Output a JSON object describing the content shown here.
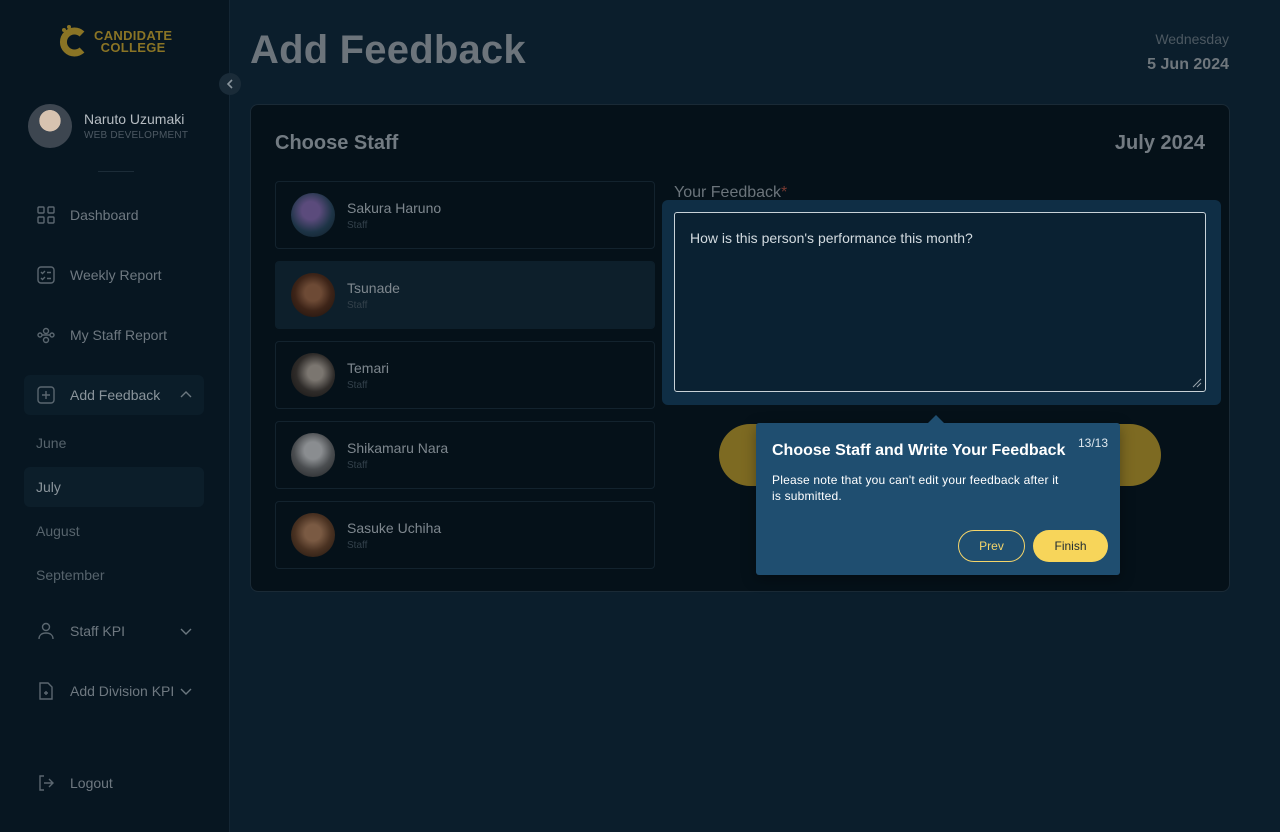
{
  "brand": {
    "line1": "CANDIDATE",
    "line2": "COLLEGE",
    "accent_color": "#f7d55a"
  },
  "user": {
    "name": "Naruto Uzumaki",
    "role": "WEB DEVELOPMENT"
  },
  "sidebar": {
    "items": [
      {
        "label": "Dashboard",
        "icon": "dashboard-grid-icon"
      },
      {
        "label": "Weekly Report",
        "icon": "checklist-icon"
      },
      {
        "label": "My Staff Report",
        "icon": "team-icon"
      },
      {
        "label": "Add Feedback",
        "icon": "plus-square-icon",
        "expanded": true
      },
      {
        "label": "Staff KPI",
        "icon": "person-icon",
        "expanded": false
      },
      {
        "label": "Add Division KPI",
        "icon": "file-add-icon",
        "expanded": false
      }
    ],
    "feedback_months": [
      "June",
      "July",
      "August",
      "September"
    ],
    "active_month": "July",
    "logout_label": "Logout"
  },
  "header": {
    "title": "Add Feedback",
    "day": "Wednesday",
    "date": "5 Jun 2024"
  },
  "card": {
    "title": "Choose Staff",
    "month": "July 2024"
  },
  "staff": [
    {
      "name": "Sakura Haruno",
      "role": "Staff"
    },
    {
      "name": "Tsunade",
      "role": "Staff",
      "selected": true
    },
    {
      "name": "Temari",
      "role": "Staff"
    },
    {
      "name": "Shikamaru Nara",
      "role": "Staff"
    },
    {
      "name": "Sasuke Uchiha",
      "role": "Staff"
    }
  ],
  "feedback": {
    "label": "Your Feedback",
    "required_mark": "*",
    "placeholder": "How is this person's performance this month?"
  },
  "tour": {
    "title": "Choose Staff and Write Your Feedback",
    "step": "13/13",
    "body": "Please note that you can't edit your feedback after it is submitted.",
    "prev_label": "Prev",
    "finish_label": "Finish"
  }
}
